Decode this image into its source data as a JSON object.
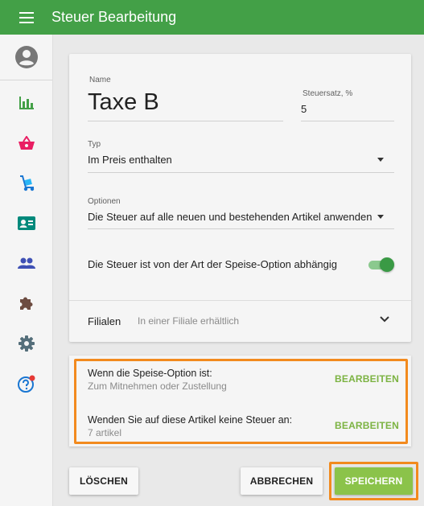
{
  "app": {
    "title": "Steuer Bearbeitung"
  },
  "icons": {
    "menu": "menu-icon",
    "avatar": "account-circle-icon",
    "reports": "bar-chart-icon",
    "items": "basket-icon",
    "inventory": "hand-truck-icon",
    "employees": "badge-icon",
    "customers": "people-icon",
    "integrations": "puzzle-icon",
    "settings": "gear-icon",
    "help": "help-icon"
  },
  "colors": {
    "primary": "#43a047",
    "accent": "#8bc34a",
    "link": "#7cb342",
    "highlight": "#f28a1e"
  },
  "form": {
    "name_label": "Name",
    "name_value": "Taxe B",
    "rate_label": "Steuersatz, %",
    "rate_value": "5",
    "type_label": "Typ",
    "type_value": "Im Preis enthalten",
    "options_label": "Optionen",
    "options_value": "Die Steuer auf alle neuen und bestehenden Artikel anwenden",
    "dining_toggle_label": "Die Steuer ist von der Art der Speise-Option abhängig",
    "dining_toggle_on": true,
    "stores_label": "Filialen",
    "stores_value": "In einer Filiale erhältlich"
  },
  "rules": {
    "condition_title": "Wenn die Speise-Option ist:",
    "condition_value": "Zum Mitnehmen oder Zustellung",
    "exempt_title": "Wenden Sie auf diese Artikel keine Steuer an:",
    "exempt_value": "7 artikel",
    "edit_label": "BEARBEITEN"
  },
  "actions": {
    "delete": "LÖSCHEN",
    "cancel": "ABBRECHEN",
    "save": "SPEICHERN"
  }
}
